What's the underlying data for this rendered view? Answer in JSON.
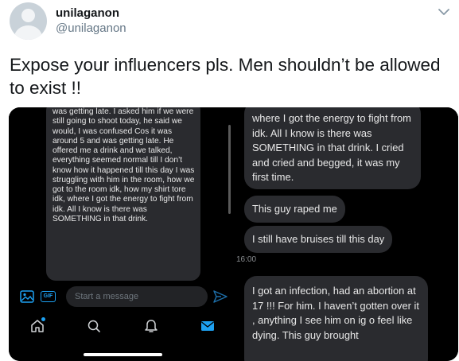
{
  "tweet": {
    "display_name": "unilaganon",
    "handle": "@unilaganon",
    "text": "Expose your influencers pls. Men shouldn’t be allowed to exist !!"
  },
  "left_screenshot": {
    "message_text": "was getting late. I asked him if we were still going to shoot today, he said we would, I was confused Cos it was around 5 and was getting late. He offered me a drink and we talked, everything seemed normal till I don’t know how it happened till this day I was struggling with him in the room, how we got to the room idk, how my shirt tore idk, where I got the energy to fight from idk. All I know is there was SOMETHING in that drink.",
    "composer_placeholder": "Start a message",
    "gif_label": "GIF",
    "icons": [
      "image-icon",
      "gif-icon",
      "send-icon",
      "home-icon",
      "search-icon",
      "notifications-icon",
      "messages-icon"
    ]
  },
  "right_screenshot": {
    "messages": [
      "where I got the energy to fight from idk. All I know is there was SOMETHING in that drink. I cried and cried and begged, it was my first time.",
      "This guy raped me",
      "I still have bruises till this day",
      "I got an infection, had an abortion at 17 !!! For him. I haven’t gotten over it , anything I see him on ig o feel like dying. This guy brought"
    ],
    "timestamp": "16:00"
  },
  "colors": {
    "accent": "#1da1f2",
    "bubble": "#2a2b2f",
    "dark_bg": "#000000"
  }
}
